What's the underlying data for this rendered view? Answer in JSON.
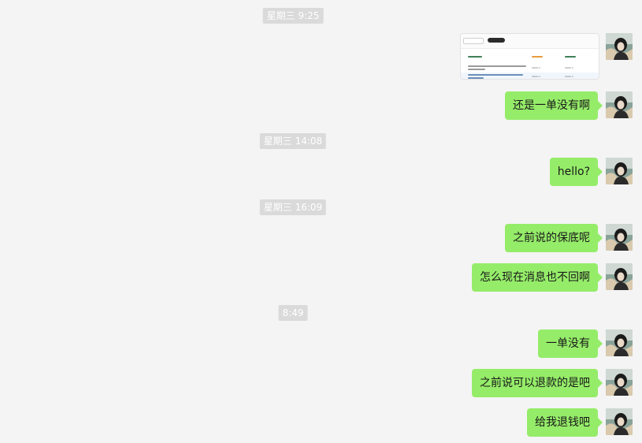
{
  "timestamps": {
    "t1": "星期三 9:25",
    "t2": "星期三 14:08",
    "t3": "星期三 16:09",
    "t4": "8:49"
  },
  "messages": {
    "m1": "还是一单没有啊",
    "m2": "hello?",
    "m3": "之前说的保底呢",
    "m4": "怎么现在消息也不回啊",
    "m5": "一单没有",
    "m6": "之前说可以退款的是吧",
    "m7": "给我退钱吧"
  },
  "image_message": {
    "date_1a": "2024-7-",
    "date_1b": "2024-7-",
    "date_2a": "2024-7-",
    "date_2b": "2024-7-",
    "header_accent": "#f0ad4e",
    "header_link": "#3a8ee6"
  },
  "colors": {
    "background": "#f4f4f4",
    "bubble_self": "#95ec69",
    "timestamp_bg": "#dadada",
    "timestamp_text": "#ffffff"
  },
  "icons": {
    "avatar": "user-avatar"
  }
}
